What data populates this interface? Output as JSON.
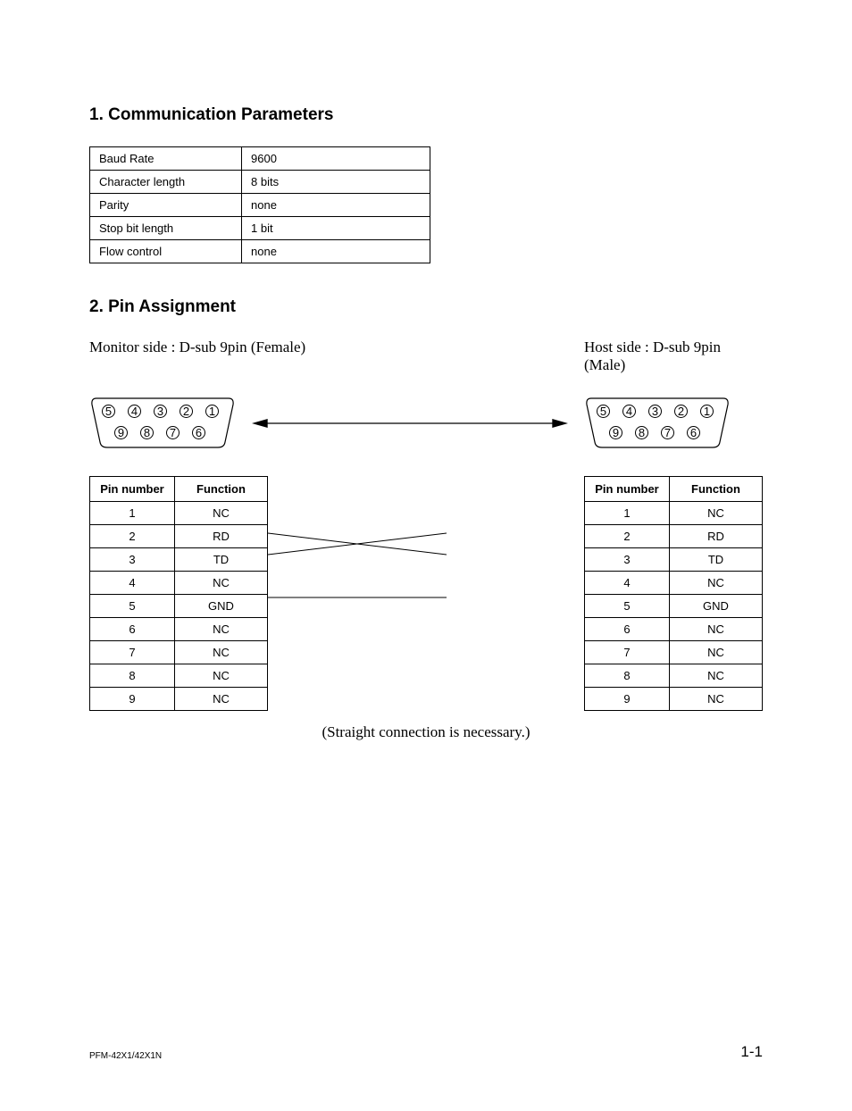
{
  "section1": {
    "title": "1.  Communication Parameters",
    "rows": [
      {
        "label": "Baud Rate",
        "value": "9600"
      },
      {
        "label": "Character length",
        "value": "8 bits"
      },
      {
        "label": "Parity",
        "value": "none"
      },
      {
        "label": "Stop bit length",
        "value": "1 bit"
      },
      {
        "label": "Flow control",
        "value": "none"
      }
    ]
  },
  "section2": {
    "title": "2.  Pin Assignment",
    "monitor_label": "Monitor side : D-sub 9pin (Female)",
    "host_label": "Host side : D-sub 9pin (Male)",
    "top_pins": [
      "5",
      "4",
      "3",
      "2",
      "1"
    ],
    "bottom_pins": [
      "9",
      "8",
      "7",
      "6"
    ],
    "table_header": {
      "col1": "Pin number",
      "col2": "Function"
    },
    "monitor_pins": [
      {
        "num": "1",
        "func": "NC"
      },
      {
        "num": "2",
        "func": "RD"
      },
      {
        "num": "3",
        "func": "TD"
      },
      {
        "num": "4",
        "func": "NC"
      },
      {
        "num": "5",
        "func": "GND"
      },
      {
        "num": "6",
        "func": "NC"
      },
      {
        "num": "7",
        "func": "NC"
      },
      {
        "num": "8",
        "func": "NC"
      },
      {
        "num": "9",
        "func": "NC"
      }
    ],
    "host_pins": [
      {
        "num": "1",
        "func": "NC"
      },
      {
        "num": "2",
        "func": "RD"
      },
      {
        "num": "3",
        "func": "TD"
      },
      {
        "num": "4",
        "func": "NC"
      },
      {
        "num": "5",
        "func": "GND"
      },
      {
        "num": "6",
        "func": "NC"
      },
      {
        "num": "7",
        "func": "NC"
      },
      {
        "num": "8",
        "func": "NC"
      },
      {
        "num": "9",
        "func": "NC"
      }
    ],
    "note": "(Straight connection is necessary.)"
  },
  "footer": {
    "left": "PFM-42X1/42X1N",
    "right": "1-1"
  }
}
